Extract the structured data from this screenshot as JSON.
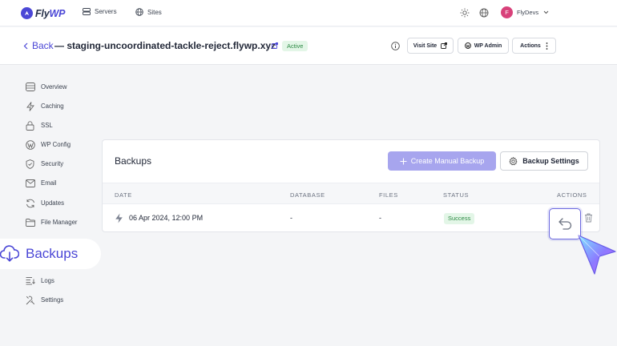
{
  "topbar": {
    "logo_prefix": "Fly",
    "logo_accent": "WP",
    "nav": [
      {
        "label": "Servers",
        "icon": "server-icon"
      },
      {
        "label": "Sites",
        "icon": "globe-icon"
      }
    ],
    "user_initial": "F",
    "user_name": "FlyDevs"
  },
  "header": {
    "back_label": "Back",
    "site_title": "— staging-uncoordinated-tackle-reject.flywp.xyz",
    "status_badge": "Active",
    "visit_site_label": "Visit Site",
    "wp_admin_label": "WP Admin",
    "actions_label": "Actions"
  },
  "sidebar": {
    "items": [
      {
        "label": "Overview",
        "icon": "overview-icon"
      },
      {
        "label": "Caching",
        "icon": "lightning-icon"
      },
      {
        "label": "SSL",
        "icon": "lock-icon"
      },
      {
        "label": "WP Config",
        "icon": "wordpress-icon"
      },
      {
        "label": "Security",
        "icon": "shield-icon"
      },
      {
        "label": "Email",
        "icon": "mail-icon"
      },
      {
        "label": "Updates",
        "icon": "refresh-icon"
      },
      {
        "label": "File Manager",
        "icon": "folder-icon"
      }
    ],
    "active": {
      "label": "Backups",
      "icon": "cloud-download-icon"
    },
    "items_after": [
      {
        "label": "Logs",
        "icon": "logs-icon"
      },
      {
        "label": "Settings",
        "icon": "tools-icon"
      }
    ]
  },
  "backups": {
    "title": "Backups",
    "create_button": "Create Manual Backup",
    "settings_button": "Backup Settings",
    "columns": [
      "DATE",
      "DATABASE",
      "FILES",
      "STATUS",
      "ACTIONS"
    ],
    "rows": [
      {
        "date": "06 Apr 2024, 12:00 PM",
        "database": "-",
        "files": "-",
        "status": "Success"
      }
    ]
  },
  "colors": {
    "brand": "#4b47d6",
    "success_bg": "#e3f6e7",
    "success_text": "#2e8a45"
  }
}
